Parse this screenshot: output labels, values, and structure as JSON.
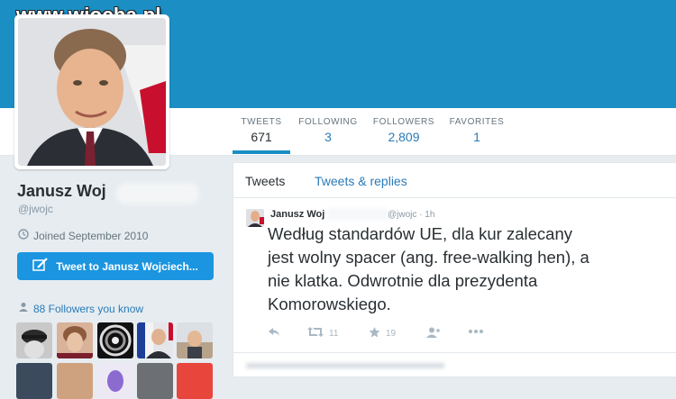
{
  "watermark": "www.wiocha.pl",
  "stats": [
    {
      "label": "TWEETS",
      "value": "671"
    },
    {
      "label": "FOLLOWING",
      "value": "3"
    },
    {
      "label": "FOLLOWERS",
      "value": "2,809"
    },
    {
      "label": "FAVORITES",
      "value": "1"
    }
  ],
  "profile": {
    "name": "Janusz Woj",
    "handle": "@jwojc",
    "joined": "Joined September 2010",
    "tweet_to_label": "Tweet to Janusz Wojciech...",
    "followers_you_know": "88 Followers you know"
  },
  "timeline": {
    "tabs": [
      "Tweets",
      "Tweets & replies"
    ],
    "tweet": {
      "name": "Janusz Woj",
      "handle_time": "@jwojc · 1h",
      "lines": [
        "Według standardów UE, dla kur zalecany",
        "jest wolny spacer (ang. free-walking hen), a",
        "nie klatka. Odwrotnie dla prezydenta",
        "Komorowskiego."
      ],
      "retweets": "11",
      "favorites": "19"
    }
  },
  "colors": {
    "banner": "#1b8fc4",
    "link": "#2a7bb7",
    "button": "#1b95e0"
  }
}
